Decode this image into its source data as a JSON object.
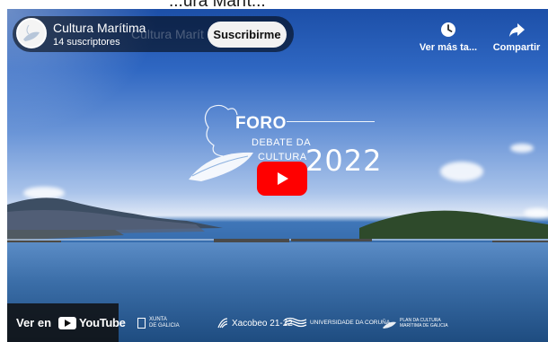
{
  "channel": {
    "name": "Cultura Marítima",
    "subscribers": "14 suscriptores",
    "ghost_title": "Cultura Marít",
    "subscribe_label": "Suscribirme"
  },
  "page_top_text": "...ura Marít...",
  "actions": {
    "watch_later_label": "Ver más ta...",
    "share_label": "Compartir"
  },
  "video_title_card": {
    "foro": "FORO",
    "line1": "DEBATE DA",
    "line2": "CULTURA",
    "year": "2022"
  },
  "bottom_bar": {
    "watch_on": "Ver en",
    "youtube": "YouTube"
  },
  "sponsors": {
    "xunta": "XUNTA\nDE GALICIA",
    "xacobeo": "Xacobeo 21-22",
    "udc": "UNIVERSIDADE DA CORUÑA",
    "plan": "PLAN DA CULTURA\nMARÍTIMA DE GALICIA"
  },
  "colors": {
    "play_red": "#ff0000",
    "pill_bg": "rgba(0,0,0,0.55)",
    "subscribe_bg": "#f2f2f2"
  },
  "icons": {
    "watch_later": "clock-icon",
    "share": "share-arrow-icon",
    "play": "play-icon"
  }
}
